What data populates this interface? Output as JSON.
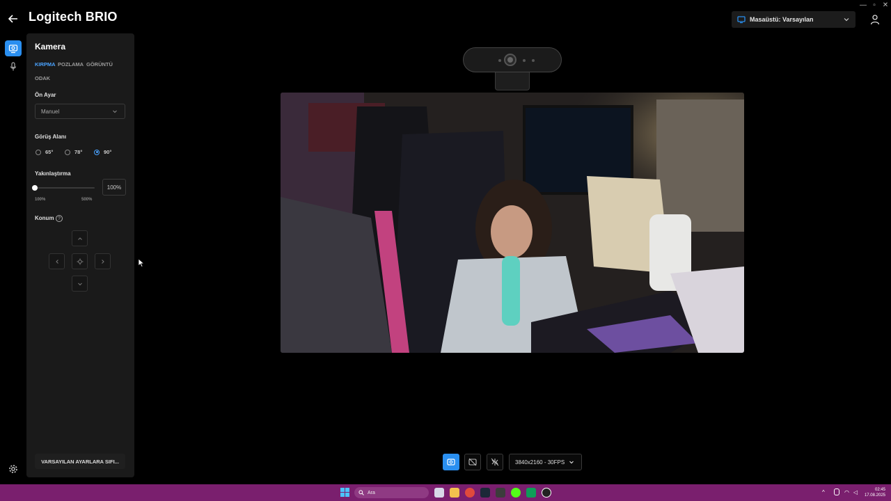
{
  "app": {
    "title": "Logitech BRIO",
    "profile_label": "Masaüstü: Varsayılan"
  },
  "panel": {
    "title": "Kamera",
    "tabs": [
      {
        "label": "KIRPMA",
        "active": true
      },
      {
        "label": "POZLAMA",
        "active": false
      },
      {
        "label": "GÖRÜNTÜ",
        "active": false
      },
      {
        "label": "ODAK",
        "active": false
      }
    ],
    "preset": {
      "label": "Ön Ayar",
      "value": "Manuel"
    },
    "fov": {
      "label": "Görüş Alanı",
      "options": [
        "65°",
        "78°",
        "90°"
      ],
      "selected": "90°"
    },
    "zoom": {
      "label": "Yakınlaştırma",
      "value": "100%",
      "min_label": "100%",
      "max_label": "500%",
      "level": 0
    },
    "position": {
      "label": "Konum",
      "help": "?"
    },
    "reset_label": "VARSAYILAN AYARLARA SIFI..."
  },
  "toolbar": {
    "resolution": "3840x2160 - 30FPS"
  },
  "taskbar": {
    "search_placeholder": "Ara",
    "time": "02:45",
    "date": "17.08.2025"
  },
  "colors": {
    "accent": "#2a8ff0",
    "taskbar": "#7a1f6e",
    "panel": "#1a1a1a"
  }
}
